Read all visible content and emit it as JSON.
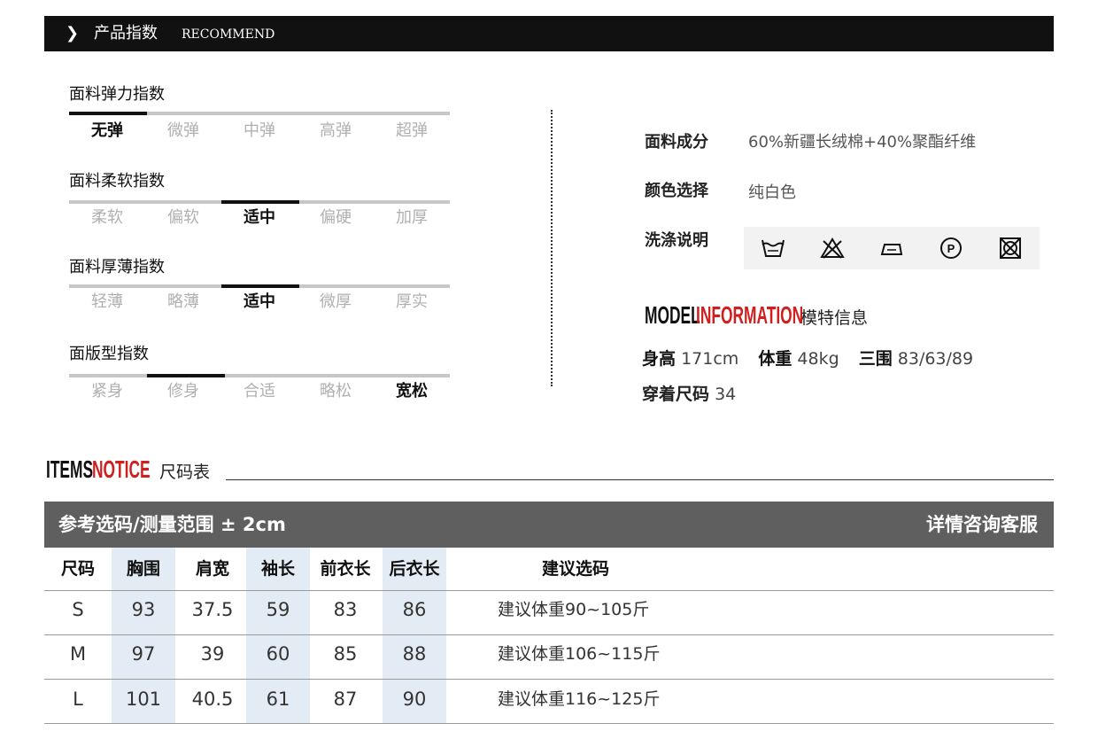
{
  "header": {
    "arrow_icon": "chevron-right-icon",
    "title": "产品指数",
    "subtitle": "RECOMMEND"
  },
  "indices": [
    {
      "title": "面料弹力指数",
      "options": [
        "无弹",
        "微弹",
        "中弹",
        "高弹",
        "超弹"
      ],
      "selected": 0
    },
    {
      "title": "面料柔软指数",
      "options": [
        "柔软",
        "偏软",
        "适中",
        "偏硬",
        "加厚"
      ],
      "selected": 2
    },
    {
      "title": "面料厚薄指数",
      "options": [
        "轻薄",
        "略薄",
        "适中",
        "微厚",
        "厚实"
      ],
      "selected": 2
    },
    {
      "title": "面版型指数",
      "options": [
        "紧身",
        "修身",
        "合适",
        "略松",
        "宽松"
      ],
      "selected": 4
    }
  ],
  "info": {
    "fabric_label": "面料成分",
    "fabric_value": "60%新疆长绒棉+40%聚酯纤维",
    "color_label": "颜色选择",
    "color_value": "纯白色",
    "wash_label": "洗涤说明",
    "wash_icons": [
      "hand-wash-icon",
      "do-not-bleach-icon",
      "iron-icon",
      "dry-clean-p-icon",
      "do-not-tumble-dry-icon"
    ]
  },
  "model": {
    "title_word1": "MODEL",
    "title_word2": "INFORMATION",
    "title_cn": "模特信息",
    "height_label": "身高",
    "height_value": "171cm",
    "weight_label": "体重",
    "weight_value": "48kg",
    "measure_label": "三围",
    "measure_value": "83/63/89",
    "size_label": "穿着尺码",
    "size_value": "34"
  },
  "notice": {
    "word1": "ITEMS",
    "word2": "NOTICE",
    "cn": "尺码表"
  },
  "size_table": {
    "header_left": "参考选码/测量范围 ± 2cm",
    "header_right": "详情咨询客服",
    "columns": [
      "尺码",
      "胸围",
      "肩宽",
      "袖长",
      "前衣长",
      "后衣长",
      "建议选码"
    ],
    "rows": [
      [
        "S",
        "93",
        "37.5",
        "59",
        "83",
        "86",
        "建议体重90~105斤"
      ],
      [
        "M",
        "97",
        "39",
        "60",
        "85",
        "88",
        "建议体重106~115斤"
      ],
      [
        "L",
        "101",
        "40.5",
        "61",
        "87",
        "90",
        "建议体重116~125斤"
      ]
    ]
  },
  "colors": {
    "header_bg": "#111111",
    "accent_red": "#d01f1f",
    "table_header_bg": "#5f5f5f",
    "column_shade": "#e3ecf4"
  }
}
